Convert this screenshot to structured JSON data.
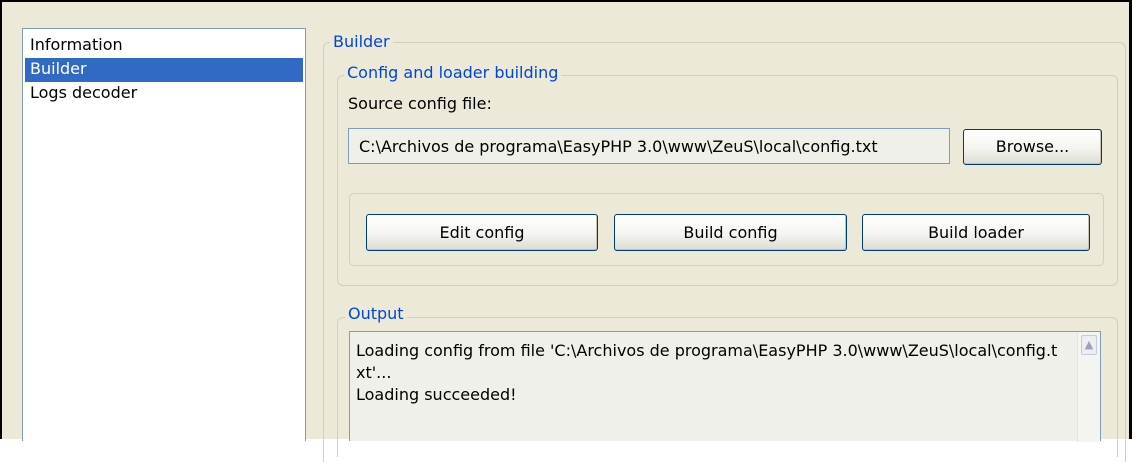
{
  "nav": {
    "items": [
      {
        "label": "Information",
        "selected": false
      },
      {
        "label": "Builder",
        "selected": true
      },
      {
        "label": "Logs decoder",
        "selected": false
      }
    ]
  },
  "builder": {
    "group_title": "Builder",
    "config_group": {
      "title": "Config and loader building",
      "source_label": "Source config file:",
      "source_value": "C:\\Archivos de programa\\EasyPHP 3.0\\www\\ZeuS\\local\\config.txt",
      "browse_label": "Browse...",
      "edit_config_label": "Edit config",
      "build_config_label": "Build config",
      "build_loader_label": "Build loader"
    },
    "output": {
      "title": "Output",
      "text": "Loading config from file 'C:\\Archivos de programa\\EasyPHP 3.0\\www\\ZeuS\\local\\config.txt'...\nLoading succeeded!"
    }
  },
  "colors": {
    "group_title": "#0046d5",
    "selection": "#316ac5",
    "window_bg": "#ece9d8"
  },
  "icons": {
    "scroll_up": "chevron-up-icon"
  }
}
